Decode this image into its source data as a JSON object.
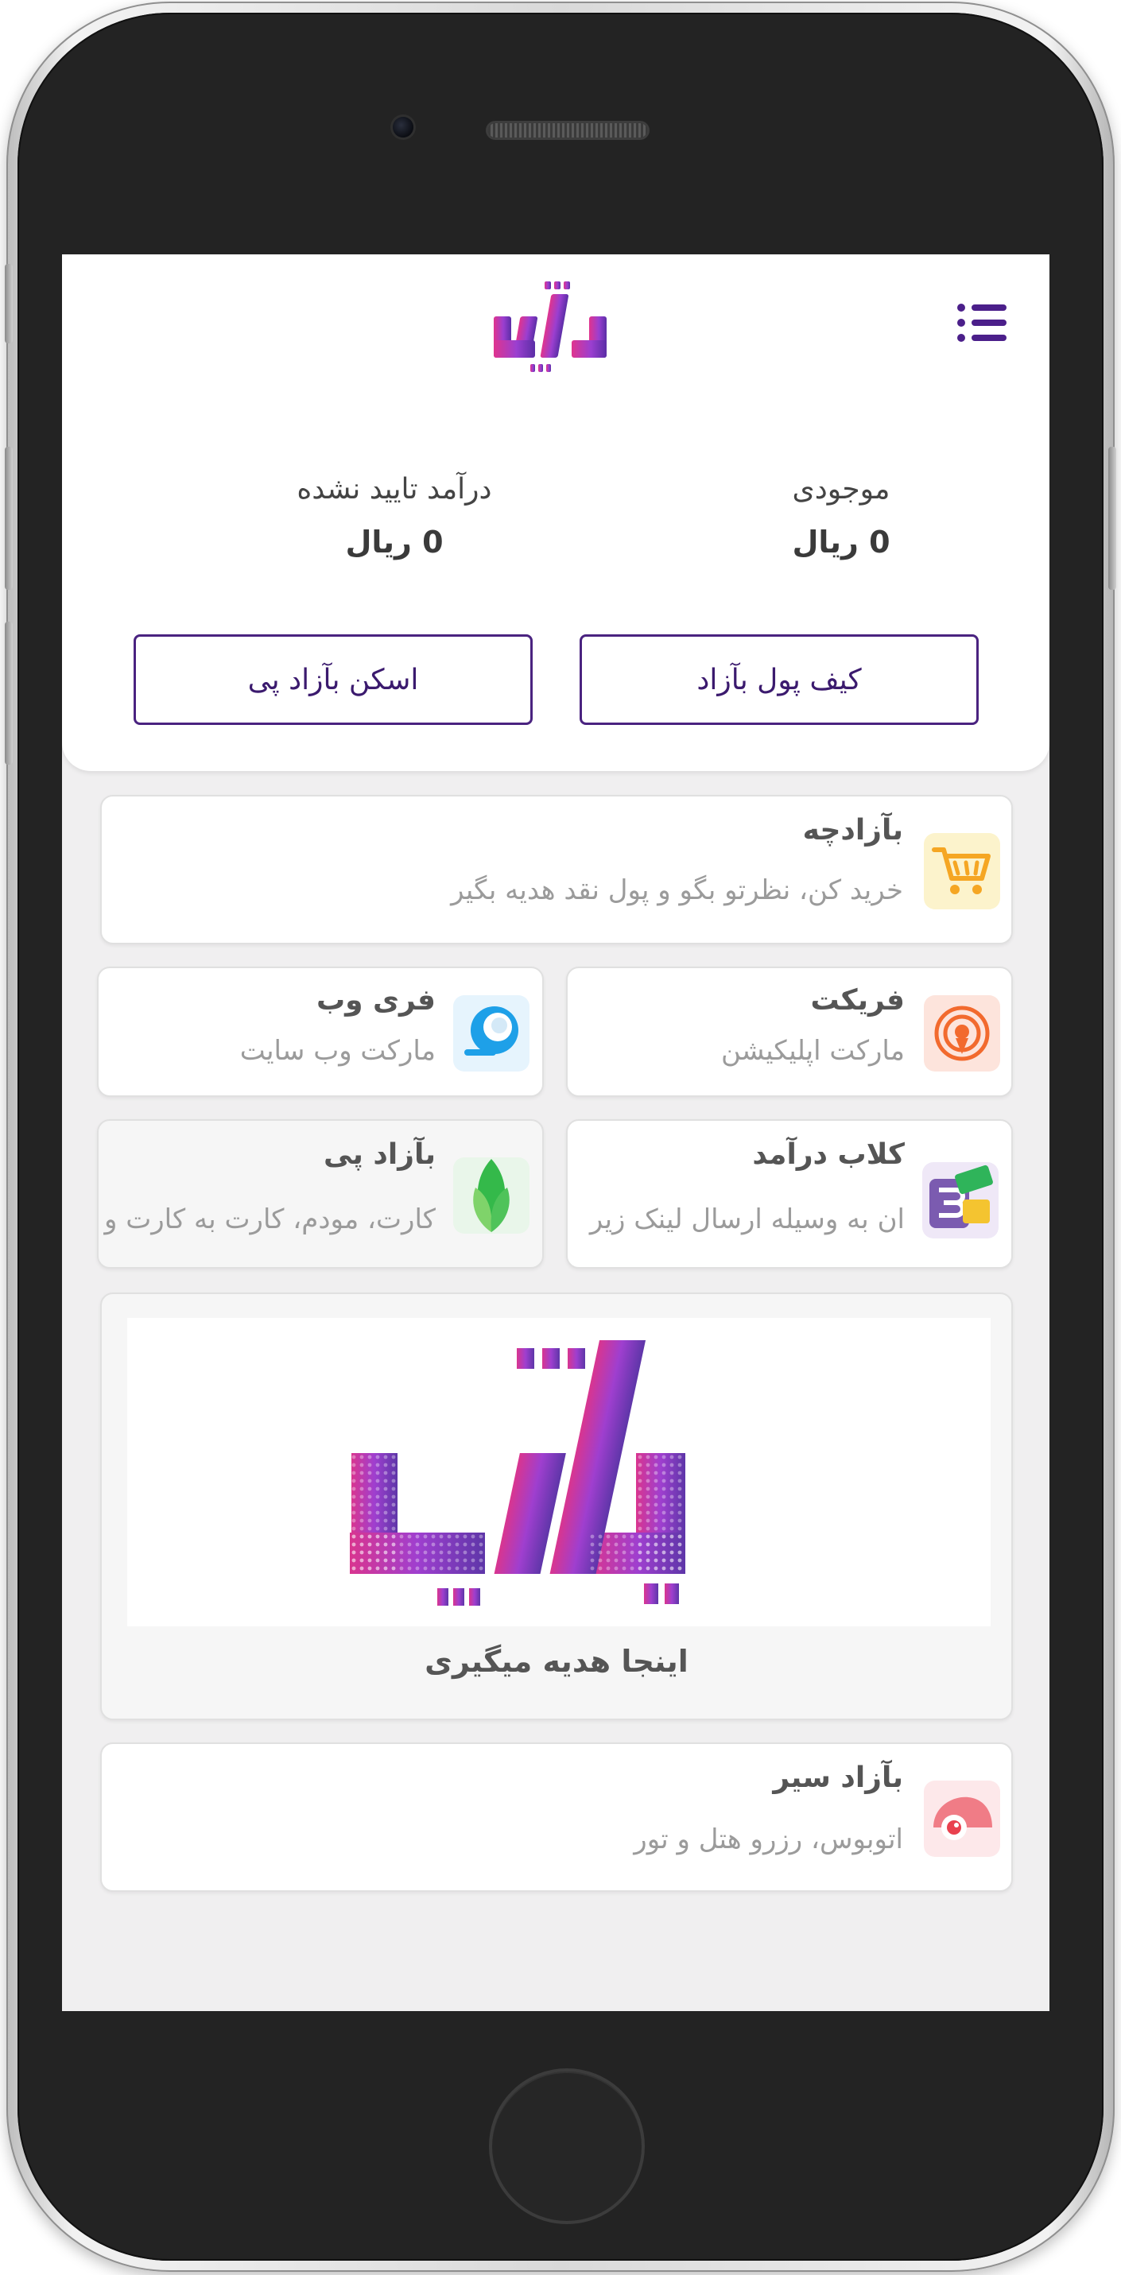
{
  "header": {
    "logo_alt": "بازاد"
  },
  "balances": {
    "balance_label": "موجودی",
    "balance_value": "0 ریال",
    "unconfirmed_label": "درآمد تایید نشده",
    "unconfirmed_value": "0 ریال"
  },
  "actions": {
    "wallet_label": "کیف پول بآزاد",
    "scan_label": "اسکن بآزاد پی"
  },
  "cards": {
    "bazarcheh": {
      "title": "بآزادچه",
      "desc": "خرید کن، نظرتو بگو و پول نقد هدیه بگیر",
      "icon": "shopping-cart-icon"
    },
    "freekat": {
      "title": "فریکت",
      "desc": "مارکت اپلیکیشن",
      "icon": "freekat-app-icon"
    },
    "freeweb": {
      "title": "فری وب",
      "desc": "مارکت وب سایت",
      "icon": "freeweb-icon"
    },
    "earnclub": {
      "title": "کلاب درآمد",
      "desc": "کسب درآمد از طریق ارسال لینک زیر مجموعه",
      "desc_visible": "ان به وسیله ارسال لینک زیر",
      "icon": "earn-club-icon"
    },
    "bazadpay": {
      "title": "بآزاد پی",
      "desc": "کارت، مودم، کارت به کارت و",
      "icon": "leaf-icon"
    },
    "banner": {
      "caption": "اینجا هدیه میگیری"
    },
    "bazadseir": {
      "title": "بآزاد سیر",
      "desc": "اتوبوس، رزرو هتل و تور",
      "icon": "travel-icon"
    }
  },
  "colors": {
    "brand_purple": "#4b1f8a",
    "brand_pink": "#e0348e",
    "screen_bg": "#f0eff0"
  }
}
